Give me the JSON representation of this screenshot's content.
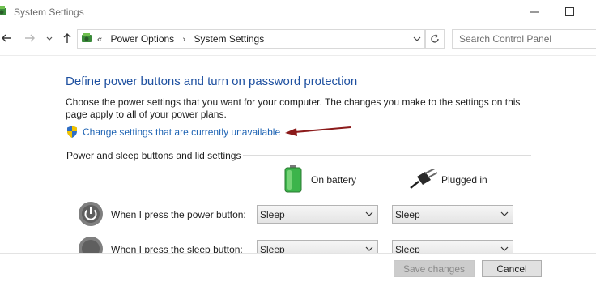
{
  "window": {
    "title": "System Settings"
  },
  "address_bar": {
    "overflow_glyph": "«",
    "breadcrumbs": [
      "Power Options",
      "System Settings"
    ],
    "separator": "›"
  },
  "search": {
    "placeholder": "Search Control Panel"
  },
  "main": {
    "heading": "Define power buttons and turn on password protection",
    "description": "Choose the power settings that you want for your computer. The changes you make to the settings on this page apply to all of your power plans.",
    "change_link": "Change settings that are currently unavailable",
    "section_title": "Power and sleep buttons and lid settings",
    "columns": {
      "on_battery": "On battery",
      "plugged_in": "Plugged in"
    },
    "rows": [
      {
        "label": "When I press the power button:",
        "on_battery": "Sleep",
        "plugged_in": "Sleep"
      },
      {
        "label": "When I press the sleep button:",
        "on_battery": "Sleep",
        "plugged_in": "Sleep"
      }
    ]
  },
  "footer": {
    "save_label": "Save changes",
    "cancel_label": "Cancel"
  },
  "colors": {
    "heading": "#1e50a0",
    "link": "#1f64b4",
    "annotation_arrow": "#8b1a1a"
  },
  "icons": [
    "power-options-icon",
    "minimize-icon",
    "maximize-icon",
    "back-arrow-icon",
    "forward-arrow-icon",
    "recent-pages-icon",
    "up-arrow-icon",
    "address-dropdown-icon",
    "refresh-icon",
    "shield-icon",
    "annotation-arrow-icon",
    "battery-icon",
    "plug-icon",
    "power-button-icon",
    "sleep-button-icon",
    "chevron-down-icon"
  ]
}
